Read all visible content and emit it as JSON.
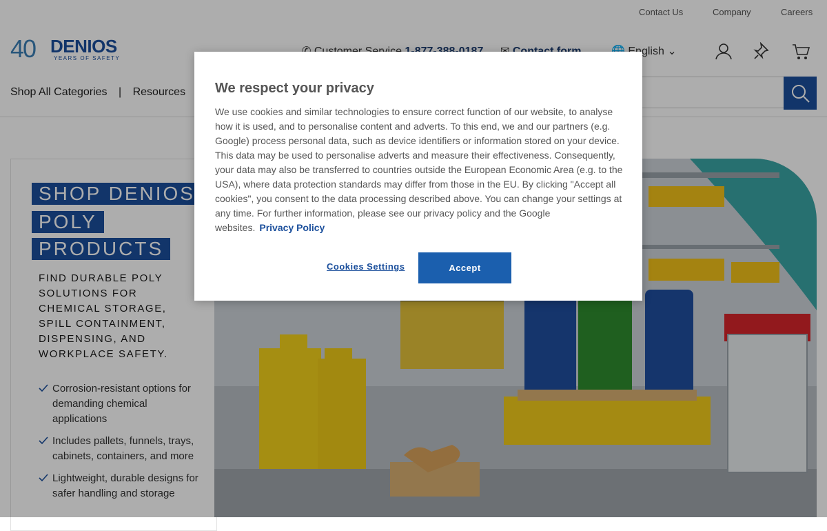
{
  "topbar": {
    "links": [
      "Contact Us",
      "Company",
      "Careers"
    ]
  },
  "logo": {
    "forty": "40",
    "brand": "DENIOS",
    "tagline": "YEARS OF SAFETY"
  },
  "header": {
    "customer_service_label": "Customer Service",
    "phone": "1-877-388-0187",
    "contact_form": "Contact form",
    "language": "English",
    "nav": [
      "Shop All Categories",
      "|",
      "Resources"
    ],
    "icons": [
      "user-icon",
      "pin-icon",
      "cart-icon",
      "search-icon"
    ]
  },
  "promo": {
    "title_lines": [
      "SHOP DENIOS",
      "POLY",
      "PRODUCTS"
    ],
    "subtitle": "FIND DURABLE POLY SOLUTIONS FOR CHEMICAL STORAGE, SPILL CONTAINMENT, DISPENSING, AND WORKPLACE SAFETY.",
    "bullets": [
      "Corrosion-resistant options for demanding chemical applications",
      "Includes pallets, funnels, trays, cabinets, containers, and more",
      "Lightweight, durable designs for safer handling and storage"
    ]
  },
  "modal": {
    "title": "We respect your privacy",
    "body": "We use cookies and similar technologies to ensure correct function of our website, to analyse how it is used, and to personalise content and adverts. To this end, we and our partners (e.g. Google) process personal data, such as device identifiers or information stored on your device. This data may be used to personalise adverts and measure their effectiveness. Consequently, your data may also be transferred to countries outside the European Economic Area (e.g. to the USA), where data protection standards may differ from those in the EU. By clicking \"Accept all cookies\", you consent to the data processing described above. You can change your settings at any time. For further information, please see our privacy policy and the Google websites.",
    "privacy_link": "Privacy Policy",
    "settings_button": "Cookies Settings",
    "accept_button": "Accept"
  },
  "colors": {
    "brand_blue": "#1b4f9c",
    "accept_blue": "#1b5fae",
    "teal": "#3aa6a6",
    "yellow": "#f2c21a"
  }
}
